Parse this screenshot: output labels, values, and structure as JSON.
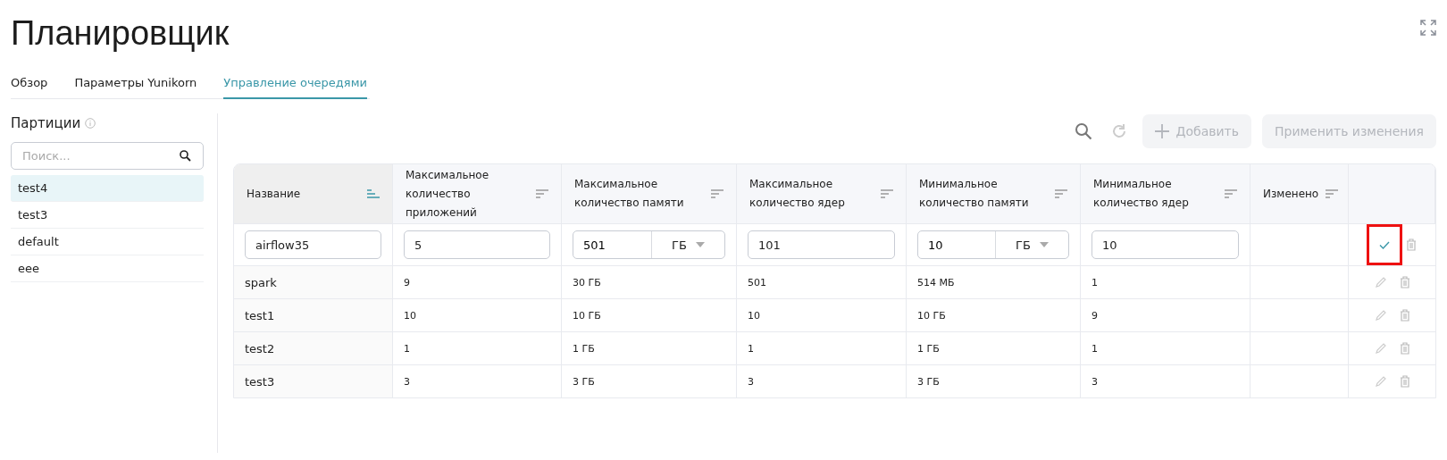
{
  "title": "Планировщик",
  "tabs": [
    {
      "label": "Обзор",
      "selected": false
    },
    {
      "label": "Параметры Yunikorn",
      "selected": false
    },
    {
      "label": "Управление очередями",
      "selected": true
    }
  ],
  "sidebar": {
    "heading": "Партиции",
    "search": {
      "placeholder": "Поиск..."
    },
    "items": [
      {
        "label": "test4",
        "selected": true
      },
      {
        "label": "test3",
        "selected": false
      },
      {
        "label": "default",
        "selected": false
      },
      {
        "label": "eee",
        "selected": false
      }
    ]
  },
  "toolbar": {
    "add_button": {
      "label": "Добавить",
      "disabled": true
    },
    "apply_button": {
      "label": "Применить изменения",
      "disabled": true
    }
  },
  "table": {
    "columns": [
      {
        "label": "Название",
        "sorted": true
      },
      {
        "label": "Максимальное количество приложений",
        "sorted": false
      },
      {
        "label": "Максимальное количество памяти",
        "sorted": false
      },
      {
        "label": "Максимальное количество ядер",
        "sorted": false
      },
      {
        "label": "Минимальное количество памяти",
        "sorted": false
      },
      {
        "label": "Минимальное количество ядер",
        "sorted": false
      },
      {
        "label": "Изменено",
        "sorted": false
      }
    ],
    "edit_row": {
      "fields": [
        {
          "kind": "text",
          "value": "airflow35"
        },
        {
          "kind": "text",
          "value": "5"
        },
        {
          "kind": "unit",
          "value": "501",
          "unit": "ГБ"
        },
        {
          "kind": "text",
          "value": "101"
        },
        {
          "kind": "unit",
          "value": "10",
          "unit": "ГБ"
        },
        {
          "kind": "text",
          "value": "10"
        }
      ],
      "confirm_highlighted": true
    },
    "rows": [
      {
        "cells": [
          "spark",
          "9",
          "30 ГБ",
          "501",
          "514 МБ",
          "1"
        ]
      },
      {
        "cells": [
          "test1",
          "10",
          "10 ГБ",
          "10",
          "10 ГБ",
          "9"
        ]
      },
      {
        "cells": [
          "test2",
          "1",
          "1 ГБ",
          "1",
          "1 ГБ",
          "1"
        ]
      },
      {
        "cells": [
          "test3",
          "3",
          "3 ГБ",
          "3",
          "3 ГБ",
          "3"
        ]
      }
    ]
  }
}
